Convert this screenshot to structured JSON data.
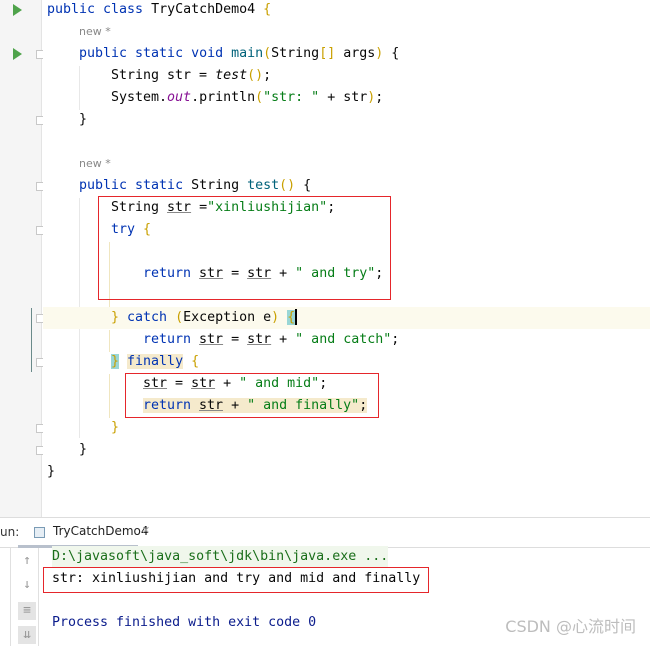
{
  "editor": {
    "lines": [
      {
        "indent": 0,
        "tokens": [
          [
            "public class ",
            "kw"
          ],
          [
            "TryCatchDemo4 ",
            ""
          ],
          [
            "{",
            "br"
          ]
        ]
      },
      {
        "indent": 1,
        "hint": "new *"
      },
      {
        "indent": 1,
        "tokens": [
          [
            "public static void ",
            "kw"
          ],
          [
            "main",
            "fn"
          ],
          [
            "(",
            "br"
          ],
          [
            "String",
            ""
          ],
          [
            "[]",
            "br"
          ],
          [
            " args",
            ""
          ],
          [
            ")",
            "br"
          ],
          [
            " {",
            ""
          ]
        ]
      },
      {
        "indent": 2,
        "tokens": [
          [
            "String str = ",
            ""
          ],
          [
            "test",
            "it"
          ],
          [
            "()",
            "br"
          ],
          [
            ";",
            ""
          ]
        ]
      },
      {
        "indent": 2,
        "tokens": [
          [
            "System.",
            ""
          ],
          [
            "out",
            "st"
          ],
          [
            ".println",
            ""
          ],
          [
            "(",
            "br"
          ],
          [
            "\"str: \"",
            "str"
          ],
          [
            " + str",
            ""
          ],
          [
            ")",
            "br"
          ],
          [
            ";",
            ""
          ]
        ]
      },
      {
        "indent": 1,
        "tokens": [
          [
            "}",
            ""
          ]
        ]
      },
      {
        "indent": 0,
        "tokens": []
      },
      {
        "indent": 1,
        "hint": "new *"
      },
      {
        "indent": 1,
        "tokens": [
          [
            "public static ",
            "kw"
          ],
          [
            "String ",
            ""
          ],
          [
            "test",
            "fn"
          ],
          [
            "()",
            "br"
          ],
          [
            " {",
            ""
          ]
        ]
      },
      {
        "indent": 2,
        "tokens": [
          [
            "String ",
            ""
          ],
          [
            "str",
            "ul"
          ],
          [
            " =",
            ""
          ],
          [
            "\"xinliushijian\"",
            "str"
          ],
          [
            ";",
            ""
          ]
        ]
      },
      {
        "indent": 2,
        "tokens": [
          [
            "try ",
            "kw"
          ],
          [
            "{",
            "br"
          ]
        ]
      },
      {
        "indent": 0,
        "tokens": []
      },
      {
        "indent": 3,
        "tokens": [
          [
            "return ",
            "kw"
          ],
          [
            "str",
            "ul"
          ],
          [
            " = ",
            ""
          ],
          [
            "str",
            "ul"
          ],
          [
            " + ",
            ""
          ],
          [
            "\" and try\"",
            "str"
          ],
          [
            ";",
            ""
          ]
        ]
      },
      {
        "indent": 0,
        "tokens": []
      },
      {
        "indent": 2,
        "current": true,
        "tokens": [
          [
            "} ",
            "br"
          ],
          [
            "catch ",
            "kw"
          ],
          [
            "(",
            "br"
          ],
          [
            "Exception e",
            ""
          ],
          [
            ") ",
            "br"
          ],
          [
            "{",
            "bm br"
          ]
        ]
      },
      {
        "indent": 3,
        "tokens": [
          [
            "return ",
            "kw"
          ],
          [
            "str",
            "ul"
          ],
          [
            " = ",
            ""
          ],
          [
            "str",
            "ul"
          ],
          [
            " + ",
            ""
          ],
          [
            "\" and catch\"",
            "str"
          ],
          [
            ";",
            ""
          ]
        ]
      },
      {
        "indent": 2,
        "tokens": [
          [
            "}",
            "bm br"
          ],
          [
            " ",
            ""
          ],
          [
            "finally",
            "kw fh"
          ],
          [
            " {",
            "br"
          ]
        ]
      },
      {
        "indent": 3,
        "tokens": [
          [
            "str",
            "ul"
          ],
          [
            " = ",
            ""
          ],
          [
            "str",
            "ul"
          ],
          [
            " + ",
            ""
          ],
          [
            "\" and mid\"",
            "str"
          ],
          [
            ";",
            ""
          ]
        ]
      },
      {
        "indent": 3,
        "tokens": [
          [
            "return ",
            "kw fh"
          ],
          [
            "str",
            "ul fh"
          ],
          [
            " + ",
            "fh"
          ],
          [
            "\" and finally\"",
            "str fh"
          ],
          [
            ";",
            "fh"
          ]
        ]
      },
      {
        "indent": 2,
        "tokens": [
          [
            "}",
            "br"
          ]
        ]
      },
      {
        "indent": 1,
        "tokens": [
          [
            "}",
            ""
          ]
        ]
      },
      {
        "indent": 0,
        "tokens": [
          [
            "}",
            ""
          ]
        ]
      }
    ]
  },
  "run_panel": {
    "label": "un:",
    "tab": "TryCatchDemo4",
    "close": "×",
    "output": [
      "D:\\javasoft\\java_soft\\jdk\\bin\\java.exe ...",
      "str: xinliushijian and try and mid and finally",
      "",
      "Process finished with exit code 0"
    ]
  },
  "watermark": "CSDN @心流时间",
  "colors": {
    "keyword": "#0033b3",
    "string": "#067d17",
    "method": "#00627a",
    "highlight_box": "#e5262b"
  }
}
